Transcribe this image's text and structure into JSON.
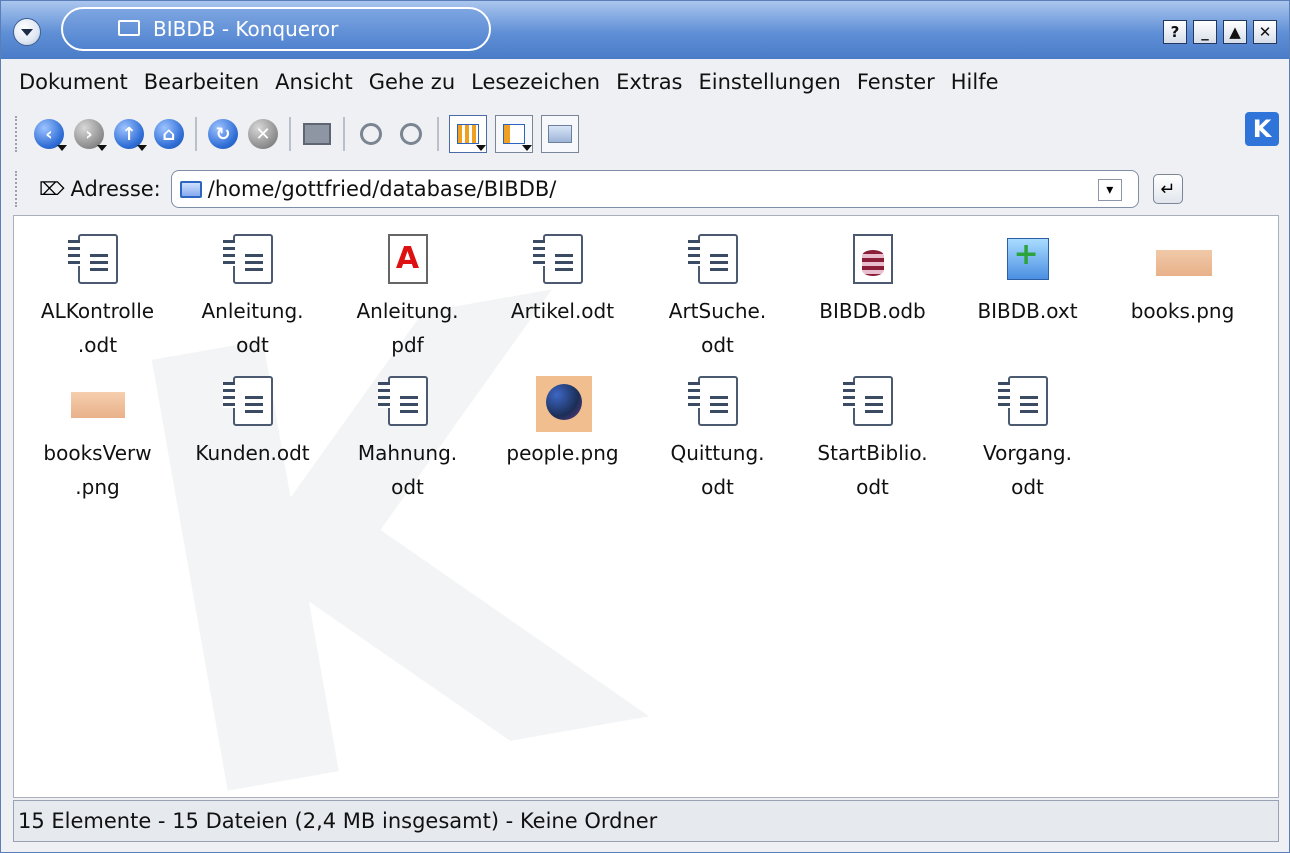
{
  "window": {
    "title": "BIBDB - Konqueror",
    "buttons": [
      "?",
      "_",
      "▲",
      "✕"
    ]
  },
  "menubar": {
    "items": [
      "Dokument",
      "Bearbeiten",
      "Ansicht",
      "Gehe zu",
      "Lesezeichen",
      "Extras",
      "Einstellungen",
      "Fenster",
      "Hilfe"
    ]
  },
  "toolbar": {
    "icons": [
      "back-icon",
      "forward-icon",
      "up-icon",
      "home-icon",
      "reload-icon",
      "stop-icon",
      "print-icon",
      "zoom-in-icon",
      "zoom-out-icon",
      "icon-view-icon",
      "tree-view-icon",
      "thumbnail-view-icon"
    ]
  },
  "address": {
    "label": "Adresse:",
    "value": "/home/gottfried/database/BIBDB/"
  },
  "files": [
    {
      "name": "ALKontrolle\n.odt",
      "icon": "odt-document-icon"
    },
    {
      "name": "Anleitung.\nodt",
      "icon": "odt-document-icon"
    },
    {
      "name": "Anleitung.\npdf",
      "icon": "pdf-document-icon"
    },
    {
      "name": "Artikel.odt",
      "icon": "odt-document-icon"
    },
    {
      "name": "ArtSuche.\nodt",
      "icon": "odt-document-icon"
    },
    {
      "name": "BIBDB.odb",
      "icon": "database-file-icon"
    },
    {
      "name": "BIBDB.oxt",
      "icon": "extension-file-icon"
    },
    {
      "name": "books.png",
      "icon": "image-file-icon"
    },
    {
      "name": "booksVerw\n.png",
      "icon": "image-file-icon"
    },
    {
      "name": "Kunden.odt",
      "icon": "odt-document-icon"
    },
    {
      "name": "Mahnung.\nodt",
      "icon": "odt-document-icon"
    },
    {
      "name": "people.png",
      "icon": "image-file-icon"
    },
    {
      "name": "Quittung.\nodt",
      "icon": "odt-document-icon"
    },
    {
      "name": "StartBiblio.\nodt",
      "icon": "odt-document-icon"
    },
    {
      "name": "Vorgang.\nodt",
      "icon": "odt-document-icon"
    }
  ],
  "status": {
    "text": "15 Elemente - 15 Dateien (2,4 MB insgesamt) - Keine Ordner"
  }
}
